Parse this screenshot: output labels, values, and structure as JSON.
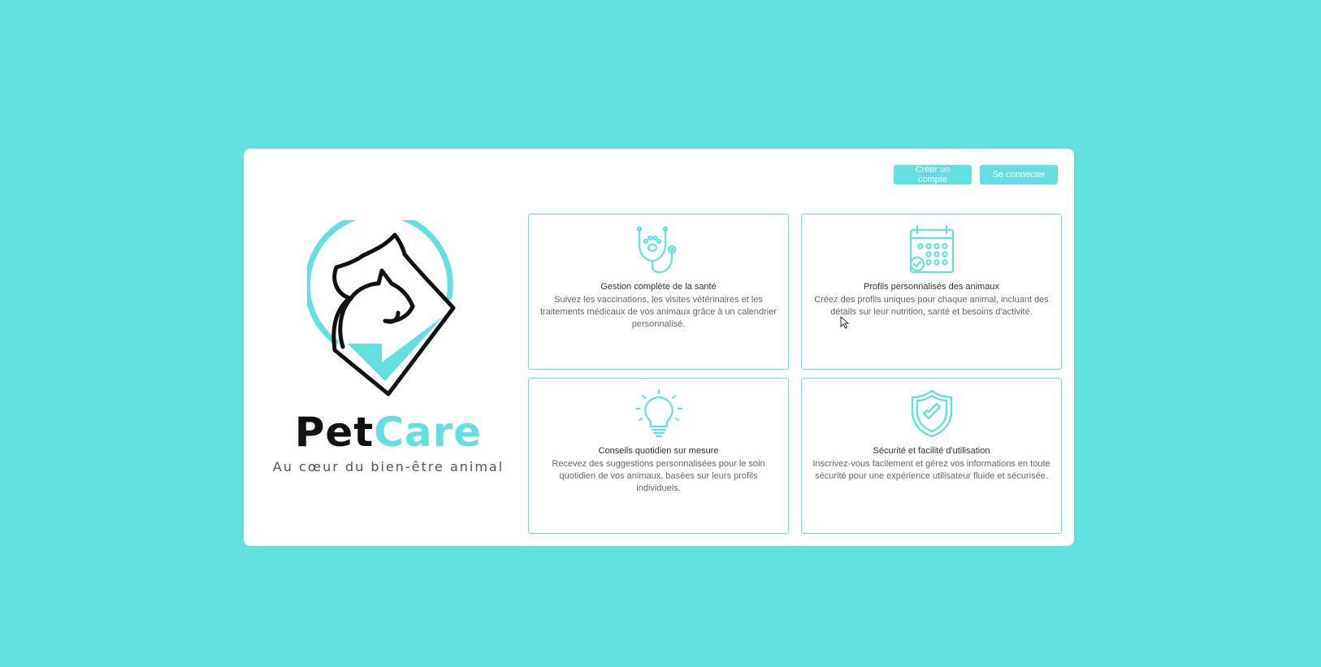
{
  "header": {
    "create_account_label": "Créer un compte",
    "login_label": "Se connecter"
  },
  "brand": {
    "name_part1": "Pet",
    "name_part2": "Care",
    "tagline": "Au cœur du bien-être animal",
    "logo_icon": "cat-dog-heart-check-logo"
  },
  "features": [
    {
      "icon": "stethoscope-paw-icon",
      "title": "Gestion complète de la santé",
      "description": "Suivez les vaccinations, les visites vétérinaires et les traitements médicaux de vos animaux grâce à un calendrier personnalisé."
    },
    {
      "icon": "calendar-check-icon",
      "title": "Profils personnalisés des animaux",
      "description": "Créez des profils uniques pour chaque animal, incluant des détails sur leur nutrition, santé et besoins d'activité."
    },
    {
      "icon": "lightbulb-icon",
      "title": "Conseils quotidien sur mesure",
      "description": "Recevez des suggestions personnalisées pour le soin quotidien de vos animaux, basées sur leurs profils individuels."
    },
    {
      "icon": "shield-check-icon",
      "title": "Sécurité et facilité d'utilisation",
      "description": "Inscrivez-vous facilement et gérez vos informations en toute sécurité pour une expérience utilisateur fluide et sécurisée."
    }
  ],
  "colors": {
    "accent": "#62e0df",
    "background": "#62e0df",
    "panel": "#ffffff",
    "text_dark": "#111111"
  }
}
